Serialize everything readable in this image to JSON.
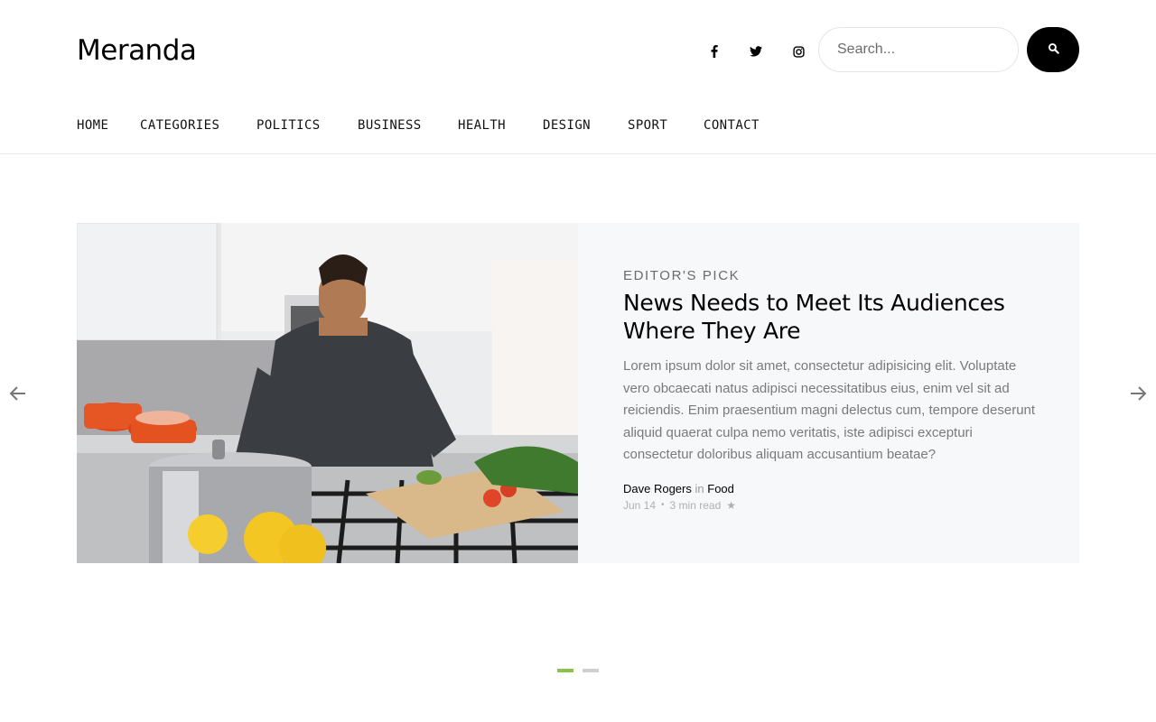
{
  "header": {
    "logo": "Meranda",
    "social": [
      {
        "name": "facebook-icon"
      },
      {
        "name": "twitter-icon"
      },
      {
        "name": "instagram-icon"
      }
    ],
    "search": {
      "placeholder": "Search...",
      "value": ""
    }
  },
  "nav": {
    "items": [
      {
        "label": "HOME"
      },
      {
        "label": "CATEGORIES"
      },
      {
        "label": "POLITICS"
      },
      {
        "label": "BUSINESS"
      },
      {
        "label": "HEALTH"
      },
      {
        "label": "DESIGN"
      },
      {
        "label": "SPORT"
      },
      {
        "label": "CONTACT"
      }
    ]
  },
  "slide": {
    "kicker": "EDITOR'S PICK",
    "headline": "News Needs to Meet Its Audiences Where They Are",
    "excerpt": "Lorem ipsum dolor sit amet, consectetur adipisicing elit. Voluptate vero obcaecati natus adipisci necessitatibus eius, enim vel sit ad reiciendis. Enim praesentium magni delectus cum, tempore deserunt aliquid quaerat culpa nemo veritatis, iste adipisci excepturi consectetur doloribus aliquam accusantium beatae?",
    "author": "Dave Rogers",
    "in_word": "in",
    "category": "Food",
    "date": "Jun 14",
    "separator": "•",
    "read_time": "3 min read",
    "star_icon": "★"
  },
  "carousel": {
    "active_index": 0,
    "slide_count": 2
  },
  "colors": {
    "accent": "#8bc34a",
    "dark": "#000000",
    "panel": "#f7f8fa",
    "muted": "#7a7a7a"
  }
}
